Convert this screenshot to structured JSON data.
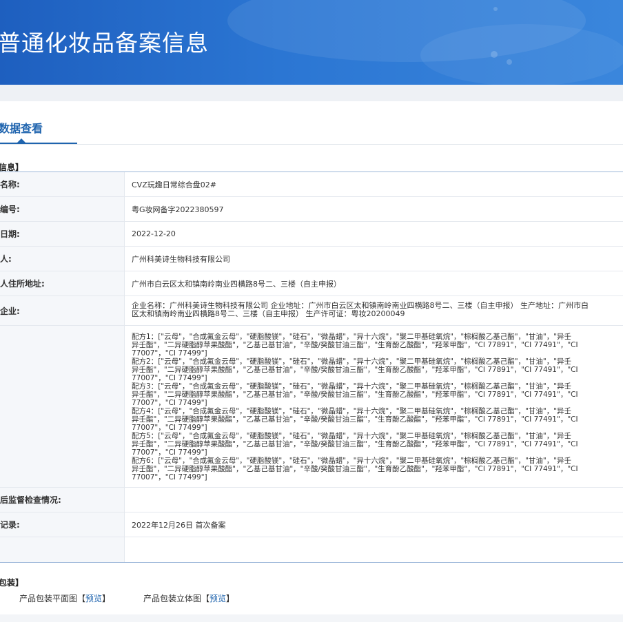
{
  "banner": {
    "title": "普通化妆品备案信息"
  },
  "tabs": [
    {
      "label": "数据查看",
      "active": true
    }
  ],
  "section_product": {
    "title": "信息】"
  },
  "rows": [
    {
      "label": "名称:",
      "value": "CVZ玩趣日常综合盘02#"
    },
    {
      "label": "编号:",
      "value": "粤G妆网备字2022380597"
    },
    {
      "label": "日期:",
      "value": "2022-12-20"
    },
    {
      "label": "人:",
      "value": "广州科美诗生物科技有限公司"
    },
    {
      "label": "人住所地址:",
      "value": "广州市白云区太和镇南岭南业四横路8号二、三楼（自主申报）"
    },
    {
      "label": "企业:",
      "value_lines": [
        "企业名称：广州科美诗生物科技有限公司 企业地址：广州市白云区太和镇南岭南业四横路8号二、三楼（自主申报） 生产地址：广州市白",
        "区太和镇南岭南业四横路8号二、三楼（自主申报） 生产许可证：粤妆20200049"
      ]
    },
    {
      "label": "",
      "formulas": [
        {
          "name": "配方1：",
          "lines": [
            "[\"云母\"，\"合成氟金云母\"，\"硬脂酸镁\"，\"硅石\"，\"微晶蜡\"，\"异十六烷\"，\"聚二甲基硅氧烷\"，\"棕榈酸乙基己酯\"，\"甘油\"，\"异壬",
            "异壬酯\"，\"二异硬脂醇苹果酸酯\"，\"乙基己基甘油\"，\"辛酸/癸酸甘油三酯\"，\"生育酚乙酸酯\"，\"羟苯甲酯\"，\"CI 77891\"，\"CI 77491\"，\"CI",
            "77007\"，\"CI 77499\"]"
          ]
        },
        {
          "name": "配方2：",
          "lines": [
            "[\"云母\"，\"合成氟金云母\"，\"硬脂酸镁\"，\"硅石\"，\"微晶蜡\"，\"异十六烷\"，\"聚二甲基硅氧烷\"，\"棕榈酸乙基己酯\"，\"甘油\"，\"异壬",
            "异壬酯\"，\"二异硬脂醇苹果酸酯\"，\"乙基己基甘油\"，\"辛酸/癸酸甘油三酯\"，\"生育酚乙酸酯\"，\"羟苯甲酯\"，\"CI 77891\"，\"CI 77491\"，\"CI",
            "77007\"，\"CI 77499\"]"
          ]
        },
        {
          "name": "配方3：",
          "lines": [
            "[\"云母\"，\"合成氟金云母\"，\"硬脂酸镁\"，\"硅石\"，\"微晶蜡\"，\"异十六烷\"，\"聚二甲基硅氧烷\"，\"棕榈酸乙基己酯\"，\"甘油\"，\"异壬",
            "异壬酯\"，\"二异硬脂醇苹果酸酯\"，\"乙基己基甘油\"，\"辛酸/癸酸甘油三酯\"，\"生育酚乙酸酯\"，\"羟苯甲酯\"，\"CI 77891\"，\"CI 77491\"，\"CI",
            "77007\"，\"CI 77499\"]"
          ]
        },
        {
          "name": "配方4：",
          "lines": [
            "[\"云母\"，\"合成氟金云母\"，\"硬脂酸镁\"，\"硅石\"，\"微晶蜡\"，\"异十六烷\"，\"聚二甲基硅氧烷\"，\"棕榈酸乙基己酯\"，\"甘油\"，\"异壬",
            "异壬酯\"，\"二异硬脂醇苹果酸酯\"，\"乙基己基甘油\"，\"辛酸/癸酸甘油三酯\"，\"生育酚乙酸酯\"，\"羟苯甲酯\"，\"CI 77891\"，\"CI 77491\"，\"CI",
            "77007\"，\"CI 77499\"]"
          ]
        },
        {
          "name": "配方5：",
          "lines": [
            "[\"云母\"，\"合成氟金云母\"，\"硬脂酸镁\"，\"硅石\"，\"微晶蜡\"，\"异十六烷\"，\"聚二甲基硅氧烷\"，\"棕榈酸乙基己酯\"，\"甘油\"，\"异壬",
            "异壬酯\"，\"二异硬脂醇苹果酸酯\"，\"乙基己基甘油\"，\"辛酸/癸酸甘油三酯\"，\"生育酚乙酸酯\"，\"羟苯甲酯\"，\"CI 77891\"，\"CI 77491\"，\"CI",
            "77007\"，\"CI 77499\"]"
          ]
        },
        {
          "name": "配方6：",
          "lines": [
            "[\"云母\"，\"合成氟金云母\"，\"硬脂酸镁\"，\"硅石\"，\"微晶蜡\"，\"异十六烷\"，\"聚二甲基硅氧烷\"，\"棕榈酸乙基己酯\"，\"甘油\"，\"异壬",
            "异壬酯\"，\"二异硬脂醇苹果酸酯\"，\"乙基己基甘油\"，\"辛酸/癸酸甘油三酯\"，\"生育酚乙酸酯\"，\"羟苯甲酯\"，\"CI 77891\"，\"CI 77491\"，\"CI",
            "77007\"，\"CI 77499\"]"
          ]
        }
      ]
    },
    {
      "label": "后监督检查情况:",
      "value": ""
    },
    {
      "label": "记录:",
      "value": "2022年12月26日 首次备案"
    },
    {
      "label": "",
      "value": ""
    }
  ],
  "section_package": {
    "title": "包装】"
  },
  "package": [
    {
      "label": "产品包装平面图",
      "bracket_open": "【",
      "link": "预览",
      "bracket_close": "】"
    },
    {
      "label": "产品包装立体图",
      "bracket_open": "【",
      "link": "预览",
      "bracket_close": "】"
    }
  ]
}
